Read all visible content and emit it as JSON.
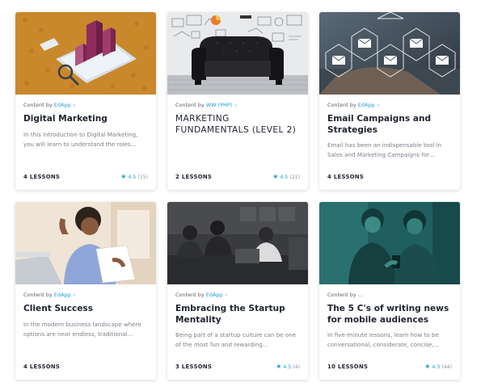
{
  "cards": [
    {
      "content_by": "Content by",
      "provider": "EdApp",
      "title": "Digital Marketing",
      "description": "In this introduction to Digital Marketing, you will learn to understand the roles…",
      "lessons": "4 LESSONS",
      "rating": "4.5",
      "rating_count": "(15)",
      "image": "isometric-analytics-illustration"
    },
    {
      "content_by": "Content by",
      "provider": "WW (PHP)",
      "title": "MARKETING FUNDAMENTALS (LEVEL 2)",
      "description": "",
      "lessons": "2 LESSONS",
      "rating": "4.5",
      "rating_count": "(21)",
      "image": "armchair-with-sketched-wall"
    },
    {
      "content_by": "Content by",
      "provider": "EdApp",
      "title": "Email Campaigns and Strategies",
      "description": "Email has been an indispensable tool in Sales and Marketing Campaigns for…",
      "lessons": "4 LESSONS",
      "rating": "",
      "rating_count": "",
      "image": "email-envelope-icons-photo"
    },
    {
      "content_by": "Content by",
      "provider": "EdApp",
      "title": "Client Success",
      "description": "In the modern business landscape where options are near endless, traditional…",
      "lessons": "4 LESSONS",
      "rating": "",
      "rating_count": "",
      "image": "woman-celebrating-laptop"
    },
    {
      "content_by": "Content by",
      "provider": "EdApp",
      "title": "Embracing the Startup Mentality",
      "description": "Being part of a startup culture can be one of the most fun and rewarding…",
      "lessons": "3 LESSONS",
      "rating": "4.5",
      "rating_count": "(4)",
      "image": "dark-office-team-photo"
    },
    {
      "content_by": "Content by",
      "provider": "...",
      "title": "The 5 C's of writing news for mobile audiences",
      "description": "In five-minute lessons, learn how to be conversational, considerate, concise,…",
      "lessons": "10 LESSONS",
      "rating": "4.3",
      "rating_count": "(44)",
      "image": "teal-two-men-phone-photo"
    }
  ]
}
